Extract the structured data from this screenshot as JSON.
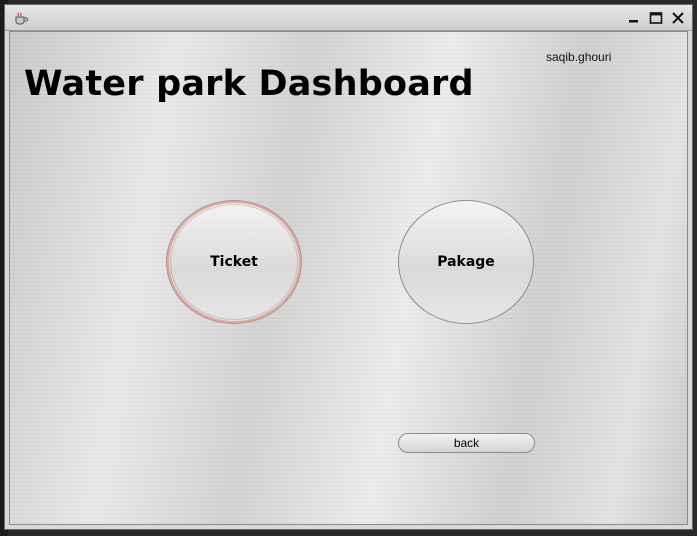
{
  "window": {
    "icon": "coffee-cup-icon",
    "controls": {
      "minimize": "minimize-icon",
      "maximize": "maximize-icon",
      "close": "close-icon"
    }
  },
  "header": {
    "username": "saqib.ghouri",
    "title": "Water park Dashboard"
  },
  "main": {
    "ticket_label": "Ticket",
    "pakage_label": "Pakage",
    "back_label": "back"
  },
  "colors": {
    "focus_ring": "#e8a497",
    "title_text": "#000000"
  }
}
